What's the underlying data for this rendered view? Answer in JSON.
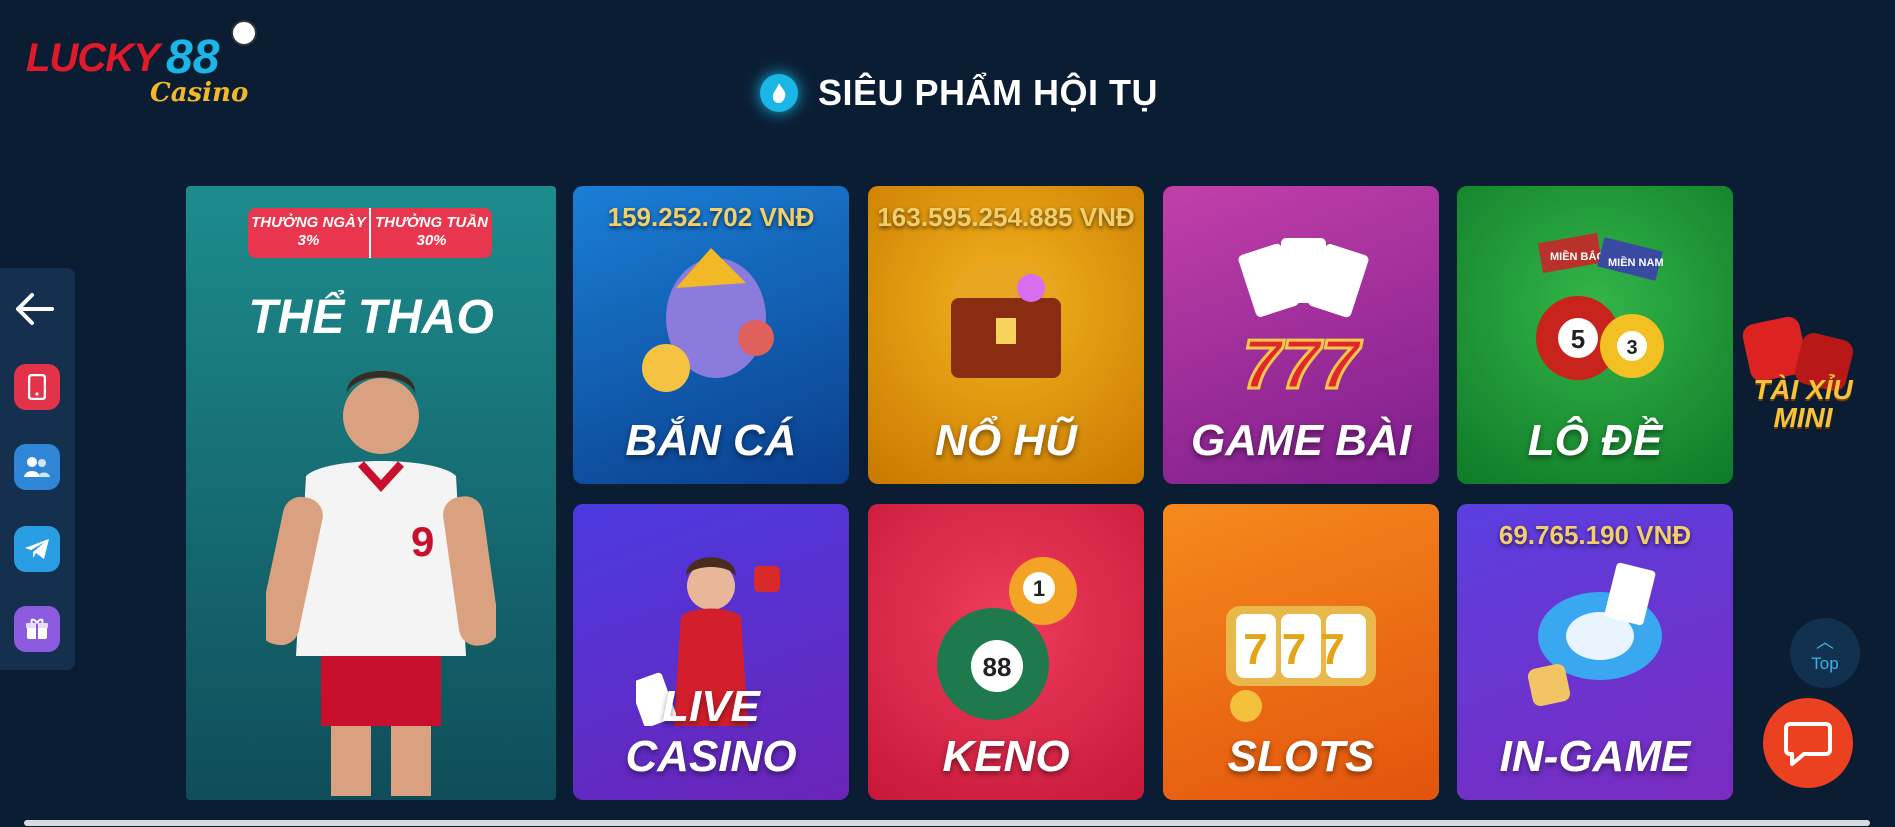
{
  "logo": {
    "brand": "LUCKY",
    "number": "88",
    "sub": "Casino"
  },
  "section": {
    "title": "SIÊU PHẨM HỘI TỤ"
  },
  "sidebar": {
    "back_icon": "arrow-left-icon",
    "buttons": [
      "mobile-icon",
      "group-icon",
      "telegram-icon",
      "gift-icon"
    ]
  },
  "sport": {
    "badge_left": "THƯỞNG NGÀY",
    "badge_left_value": "3%",
    "badge_right": "THƯỞNG TUẦN",
    "badge_right_value": "30%",
    "title": "THỂ THAO",
    "shirt_number": "9"
  },
  "tiles": {
    "ban_ca": {
      "label": "BẮN CÁ",
      "jackpot": "159.252.702 VNĐ"
    },
    "no_hu": {
      "label": "NỔ HŨ",
      "jackpot": "163.595.254.885 VNĐ"
    },
    "game_bai": {
      "label": "GAME BÀI",
      "art": "777"
    },
    "lo_de": {
      "label": "LÔ ĐỀ",
      "tag1": "MIỀN BẮC",
      "tag2": "MIỀN NAM"
    },
    "live_casino": {
      "label": "LIVE CASINO"
    },
    "keno": {
      "label": "KENO",
      "ball1": "1",
      "ball2": "88"
    },
    "slots": {
      "label": "SLOTS",
      "reels": "777"
    },
    "in_game": {
      "label": "IN-GAME",
      "jackpot": "69.765.190 VNĐ"
    }
  },
  "taixiu": {
    "line1": "TÀI XỈU",
    "line2": "MINI"
  },
  "top_button": {
    "label": "Top"
  },
  "colors": {
    "background": "#0b1d33",
    "accent": "#19b6e6",
    "chat": "#ec4121"
  }
}
